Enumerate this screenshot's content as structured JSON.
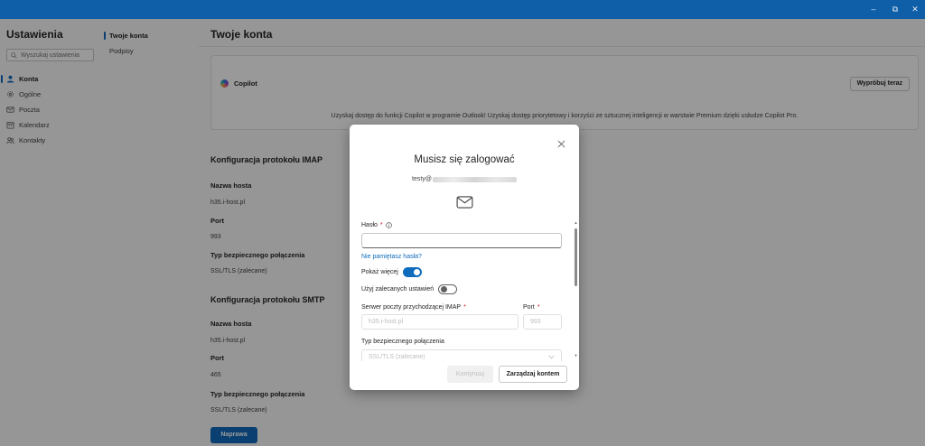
{
  "window": {
    "minimize_glyph": "–",
    "maximize_glyph": "⧉",
    "close_glyph": "✕"
  },
  "settings": {
    "title": "Ustawienia",
    "search_placeholder": "Wyszukaj ustawienia",
    "nav": [
      {
        "label": "Konta",
        "icon": "person-icon",
        "active": true
      },
      {
        "label": "Ogólne",
        "icon": "gear-icon",
        "active": false
      },
      {
        "label": "Poczta",
        "icon": "mail-icon",
        "active": false
      },
      {
        "label": "Kalendarz",
        "icon": "calendar-icon",
        "active": false
      },
      {
        "label": "Kontakty",
        "icon": "people-icon",
        "active": false
      }
    ],
    "subnav": [
      {
        "label": "Twoje konta",
        "active": true
      },
      {
        "label": "Podpisy",
        "active": false
      }
    ]
  },
  "main": {
    "title": "Twoje konta",
    "copilot": {
      "title": "Copilot",
      "try_button": "Wypróbuj teraz",
      "description": "Uzyskaj dostęp do funkcji Copilot w programie Outlook! Uzyskaj dostęp priorytetowy i korzyści ze sztucznej inteligencji w warstwie Premium dzięki usłudze Copilot Pro."
    },
    "imap": {
      "heading": "Konfiguracja protokołu IMAP",
      "host_label": "Nazwa hosta",
      "host_value": "h35.i-host.pl",
      "port_label": "Port",
      "port_value": "993",
      "security_label": "Typ bezpiecznego połączenia",
      "security_value": "SSL/TLS (zalecane)"
    },
    "smtp": {
      "heading": "Konfiguracja protokołu SMTP",
      "host_label": "Nazwa hosta",
      "host_value": "h35.i-host.pl",
      "port_label": "Port",
      "port_value": "465",
      "security_label": "Typ bezpiecznego połączenia",
      "security_value": "SSL/TLS (zalecane)"
    },
    "repair_button": "Naprawa"
  },
  "dialog": {
    "title": "Musisz się zalogować",
    "email_prefix": "testy@",
    "password_label": "Hasło",
    "required_mark": "*",
    "password_value": "",
    "forgot_link": "Nie pamiętasz hasła?",
    "show_more_label": "Pokaż więcej",
    "show_more_on": true,
    "use_recommended_label": "Użyj zalecanych ustawień",
    "use_recommended_on": false,
    "imap_server_label": "Serwer poczty przychodzącej IMAP",
    "imap_server_placeholder": "h35.i-host.pl",
    "port_label": "Port",
    "port_placeholder": "993",
    "security_label": "Typ bezpiecznego połączenia",
    "security_value": "SSL/TLS (zalecane)",
    "continue_button": "Kontynuuj",
    "manage_button": "Zarządzaj kontem"
  },
  "colors": {
    "titlebar": "#0f5ea8",
    "accent": "#0f6cbd",
    "required": "#c50f1f"
  }
}
